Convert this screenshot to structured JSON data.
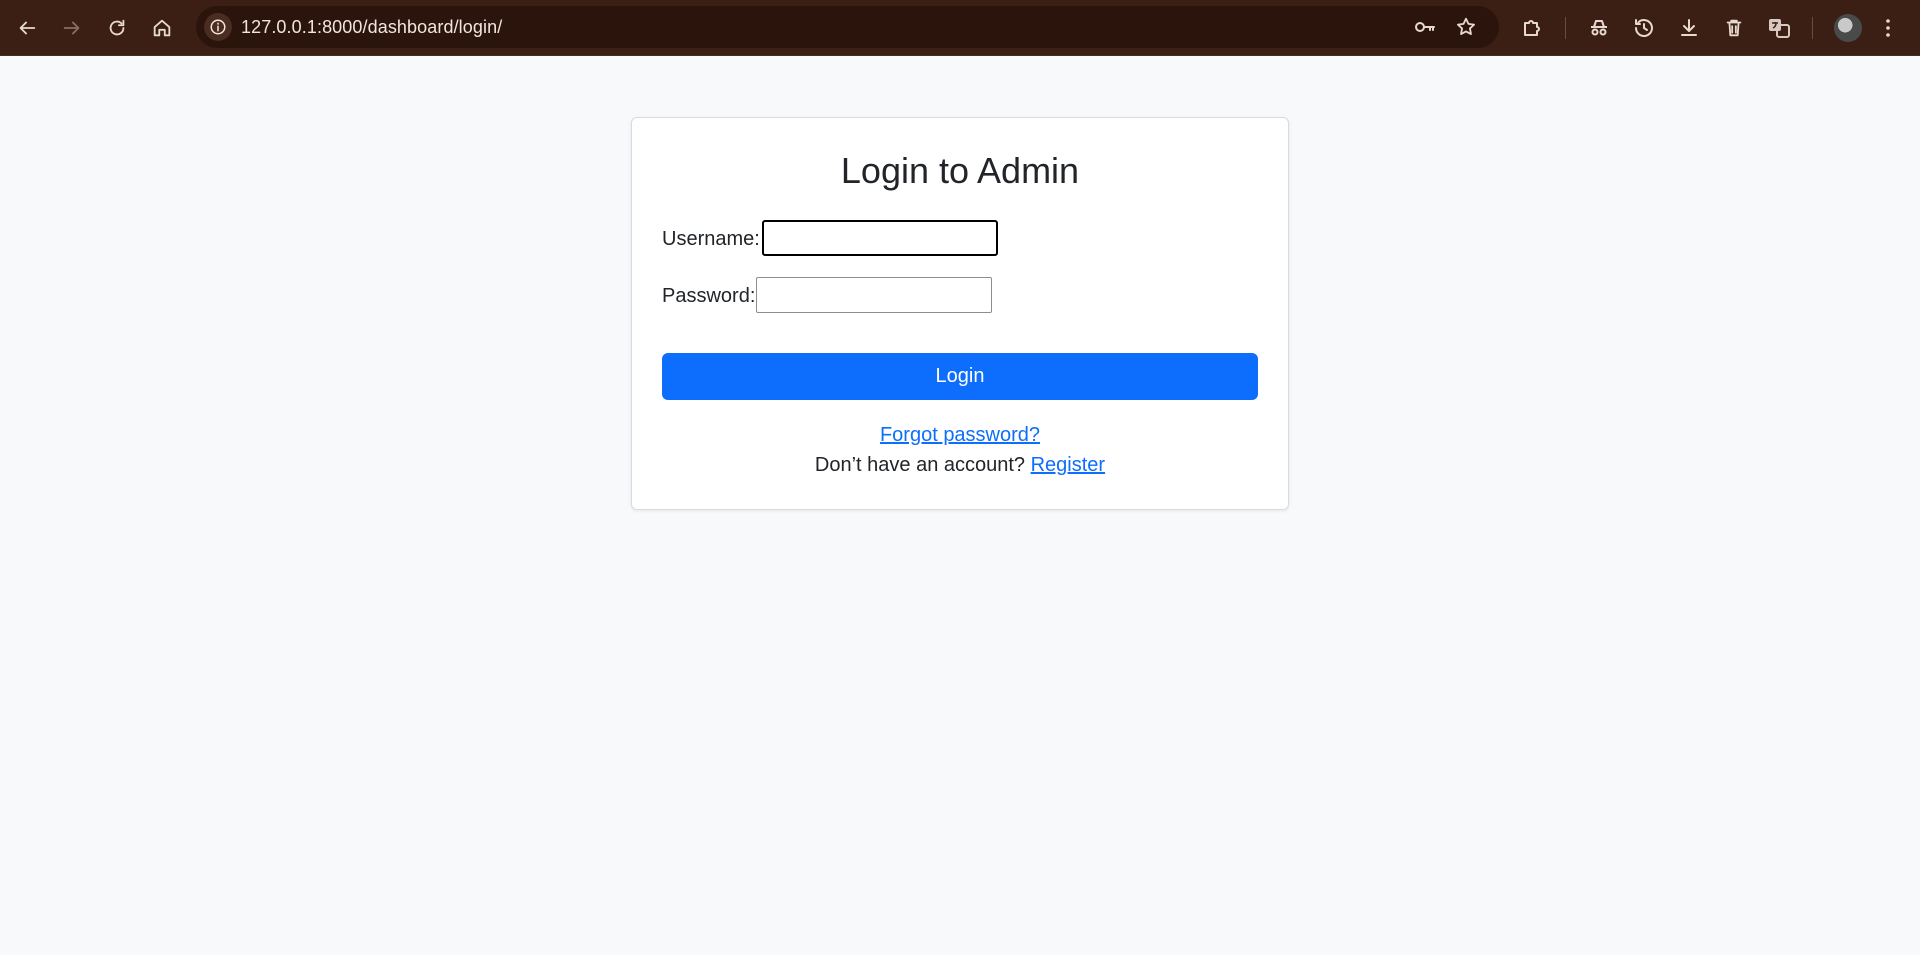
{
  "browser": {
    "url": "127.0.0.1:8000/dashboard/login/",
    "icons": {
      "back": "back-arrow-icon",
      "forward": "forward-arrow-icon",
      "reload": "reload-icon",
      "home": "home-icon",
      "site_info": "info-icon",
      "password": "key-icon",
      "bookmark": "star-icon",
      "extensions": "puzzle-icon",
      "incognito": "incognito-icon",
      "history": "history-icon",
      "downloads": "download-icon",
      "trash": "trash-icon",
      "translate": "translate-icon",
      "menu": "kebab-menu-icon"
    },
    "colors": {
      "toolbar": "#3b1f14",
      "omnibox": "#2a140c"
    }
  },
  "login": {
    "title": "Login to Admin",
    "username_label": "Username:",
    "username_value": "",
    "password_label": "Password:",
    "password_value": "",
    "submit_label": "Login",
    "forgot_link": "Forgot password?",
    "register_prompt": "Don’t have an account?",
    "register_link": "Register"
  },
  "colors": {
    "accent": "#0d6efd",
    "page_background": "#f8f9fa",
    "card_background": "#ffffff"
  }
}
